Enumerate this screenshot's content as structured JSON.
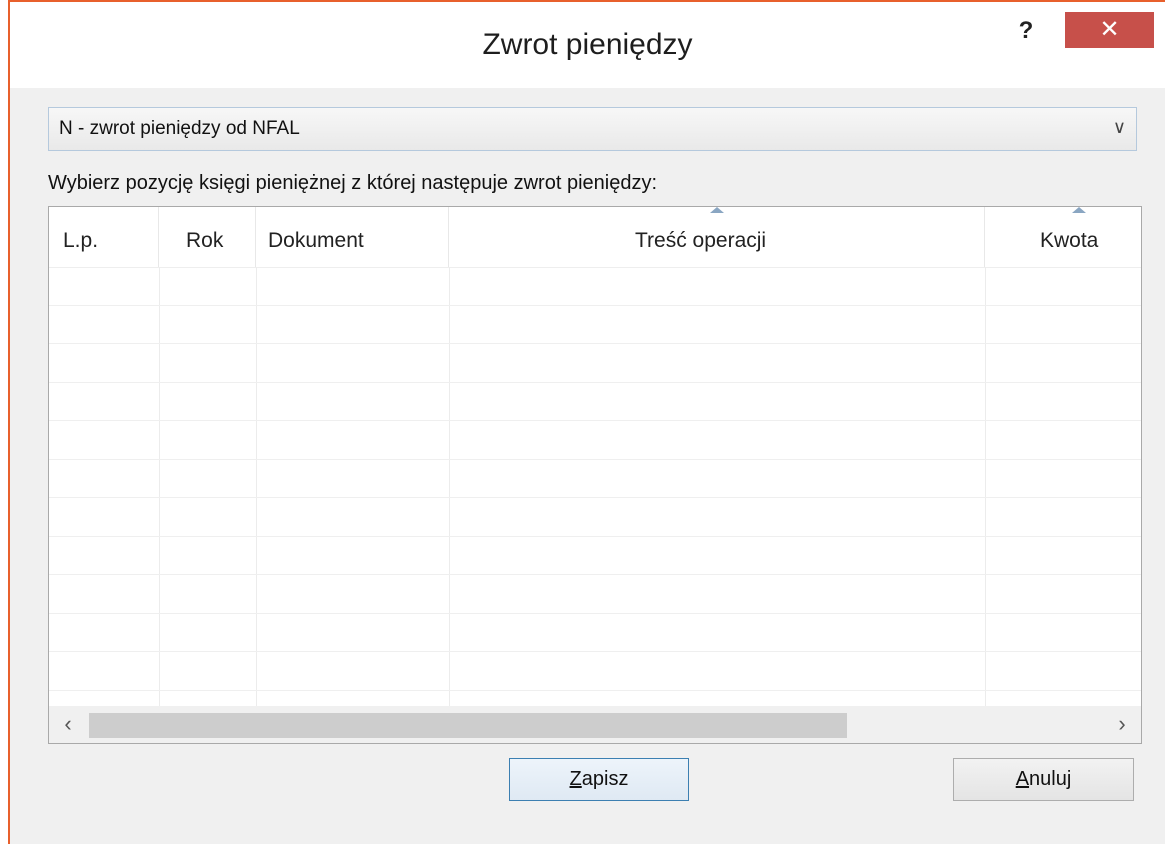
{
  "window": {
    "title": "Zwrot pieniędzy",
    "help_label": "?",
    "close_label": "✕"
  },
  "type_select": {
    "value": "N - zwrot pieniędzy od NFAL"
  },
  "instruction": "Wybierz pozycję księgi pieniężnej z której następuje zwrot pieniędzy:",
  "table": {
    "columns": [
      "L.p.",
      "Rok",
      "Dokument",
      "Treść operacji",
      "Kwota"
    ],
    "rows": []
  },
  "buttons": {
    "save": {
      "mnemonic": "Z",
      "rest": "apisz"
    },
    "cancel": {
      "mnemonic": "A",
      "rest": "nuluj"
    }
  },
  "colors": {
    "window_border": "#e8602c",
    "close_button": "#c7504a",
    "default_button_border": "#3c7fb1"
  }
}
